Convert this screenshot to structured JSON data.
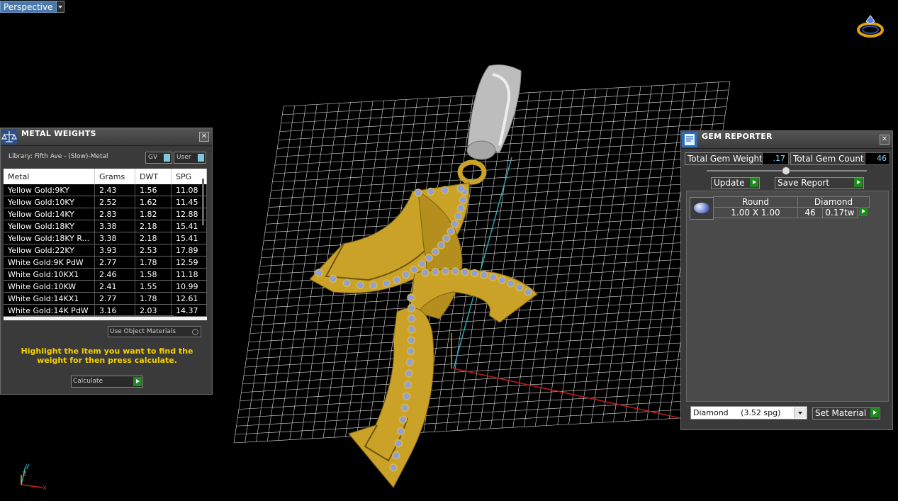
{
  "viewport": {
    "view_label": "Perspective",
    "axis_labels": {
      "x": "x",
      "y": "y",
      "z": "z"
    }
  },
  "metal_weights": {
    "title": "METAL WEIGHTS",
    "library_label": "Library: Fifth Ave - (Slow)-Metal",
    "toggle_gv": "GV",
    "toggle_user": "User",
    "columns": [
      "Metal",
      "Grams",
      "DWT",
      "SPG"
    ],
    "rows": [
      [
        "Yellow Gold:9KY",
        "2.43",
        "1.56",
        "11.08"
      ],
      [
        "Yellow Gold:10KY",
        "2.52",
        "1.62",
        "11.45"
      ],
      [
        "Yellow Gold:14KY",
        "2.83",
        "1.82",
        "12.88"
      ],
      [
        "Yellow Gold:18KY",
        "3.38",
        "2.18",
        "15.41"
      ],
      [
        "Yellow Gold:18KY R...",
        "3.38",
        "2.18",
        "15.41"
      ],
      [
        "Yellow Gold:22KY",
        "3.93",
        "2.53",
        "17.89"
      ],
      [
        "White Gold:9K PdW",
        "2.77",
        "1.78",
        "12.59"
      ],
      [
        "White Gold:10KX1",
        "2.46",
        "1.58",
        "11.18"
      ],
      [
        "White Gold:10KW",
        "2.41",
        "1.55",
        "10.99"
      ],
      [
        "White Gold:14KX1",
        "2.77",
        "1.78",
        "12.61"
      ],
      [
        "White Gold:14K PdW",
        "3.16",
        "2.03",
        "14.37"
      ]
    ],
    "use_object_materials": "Use Object Materials",
    "hint": "Highlight the item you want to find the weight for then press calculate.",
    "calculate": "Calculate"
  },
  "gem_reporter": {
    "title": "GEM REPORTER",
    "total_weight_label": "Total Gem Weight",
    "total_weight_value": ".17",
    "total_count_label": "Total Gem Count",
    "total_count_value": "46",
    "update": "Update",
    "save_report": "Save Report",
    "gem": {
      "shape": "Round",
      "material": "Diamond",
      "size": "1.00 X 1.00",
      "count": "46",
      "weight": "0.17tw"
    },
    "material_select": "Diamond     (3.52 spg)",
    "set_material": "Set Material"
  },
  "colors": {
    "grid": "#dcdcdc",
    "gold": "#c9a227",
    "gem": "#8fa0d8",
    "bail": "#b8b8b8",
    "hint": "#f6d000",
    "value_text": "#7fd7f7"
  }
}
